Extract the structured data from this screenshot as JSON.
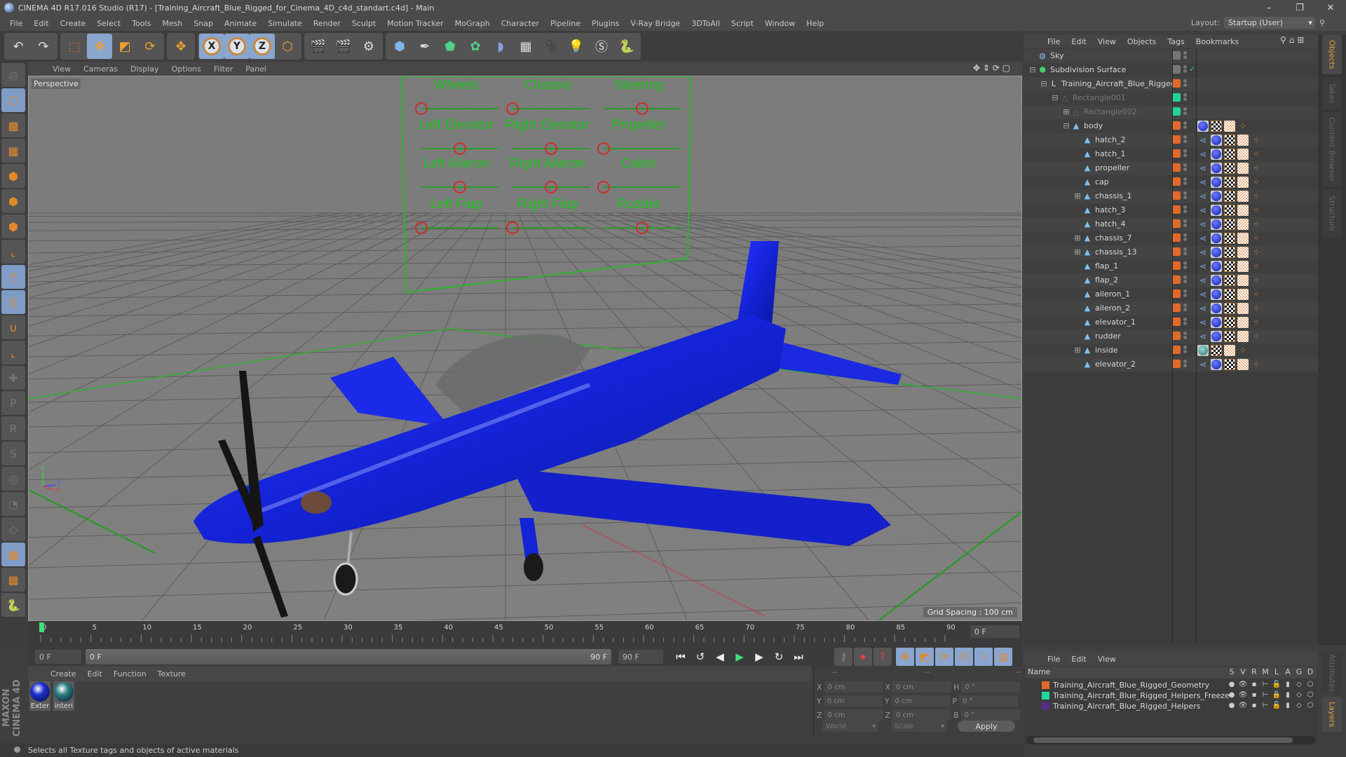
{
  "window": {
    "title": "CINEMA 4D R17.016 Studio (R17) - [Training_Aircraft_Blue_Rigged_for_Cinema_4D_c4d_standart.c4d] - Main",
    "controls": [
      "–",
      "❐",
      "✕"
    ]
  },
  "menubar": {
    "items": [
      "File",
      "Edit",
      "Create",
      "Select",
      "Tools",
      "Mesh",
      "Snap",
      "Animate",
      "Simulate",
      "Render",
      "Sculpt",
      "Motion Tracker",
      "MoGraph",
      "Character",
      "Pipeline",
      "Plugins",
      "V-Ray Bridge",
      "3DToAll",
      "Script",
      "Window",
      "Help"
    ],
    "layout_label": "Layout:",
    "layout_value": "Startup (User)"
  },
  "toolbar": {
    "groups": [
      [
        "undo-icon",
        "redo-icon"
      ],
      [
        "live-selection-icon",
        "move-icon",
        "scale-icon",
        "rotate-icon"
      ],
      [
        "recent-tool-icon"
      ],
      [
        "x-axis-icon",
        "y-axis-icon",
        "z-axis-icon",
        "coordinate-system-icon"
      ],
      [
        "render-view-icon",
        "render-picture-viewer-icon",
        "render-settings-icon"
      ],
      [
        "cube-icon",
        "pen-spline-icon",
        "subdivision-surface-icon",
        "cloner-icon",
        "deformer-icon",
        "floor-icon",
        "camera-icon",
        "light-icon",
        "vray-icon",
        "python-icon"
      ]
    ],
    "axis_labels": [
      "X",
      "Y",
      "Z"
    ]
  },
  "left_tools": [
    "make-editable-icon",
    "model-mode-icon",
    "texture-mode-icon",
    "workplane-mode-icon",
    "points-mode-icon",
    "edges-mode-icon",
    "polygons-mode-icon",
    "axis-mode-icon",
    "tweak-mode-icon",
    "solo-icon",
    "snap-icon",
    "workplane-icon",
    "add-keyframe-icon",
    "record-position-icon",
    "record-rotation-icon",
    "record-psr-icon",
    "record-param-icon",
    "record-pla-icon",
    "record-point-icon",
    "lock-workplane-icon",
    "align-workplane-icon",
    "python-icon"
  ],
  "viewport": {
    "menu": [
      "View",
      "Cameras",
      "Display",
      "Options",
      "Filter",
      "Panel"
    ],
    "label": "Perspective",
    "grid_spacing": "Grid Spacing : 100 cm",
    "nav_icons": "✥ ⇕ ⟳ ▢",
    "rig_panel": {
      "controls": [
        {
          "label": "Wheels",
          "value": 0.0
        },
        {
          "label": "Chassis",
          "value": 0.0
        },
        {
          "label": "Steering",
          "value": 0.5
        },
        {
          "label": "Left Elevator",
          "value": 0.5
        },
        {
          "label": "Right Elevator",
          "value": 0.5
        },
        {
          "label": "Propeller",
          "value": 0.0
        },
        {
          "label": "Left Aileron",
          "value": 0.5
        },
        {
          "label": "Right Aileron",
          "value": 0.5
        },
        {
          "label": "Cabin",
          "value": 0.0
        },
        {
          "label": "Left Flap",
          "value": 0.0
        },
        {
          "label": "Right Flap",
          "value": 0.0
        },
        {
          "label": "Rudder",
          "value": 0.5
        }
      ]
    },
    "axis_gizmo": [
      "Y",
      "Z",
      "X"
    ]
  },
  "timeline": {
    "ticks": [
      "0",
      "5",
      "10",
      "15",
      "20",
      "25",
      "30",
      "35",
      "40",
      "45",
      "50",
      "55",
      "60",
      "65",
      "70",
      "75",
      "80",
      "85",
      "90"
    ],
    "current_frame": "0 F",
    "start_field": "0 F",
    "range_start": "0 F",
    "range_end": "90 F",
    "end_field": "90 F"
  },
  "transport": {
    "buttons": [
      "go-to-start-icon",
      "previous-key-icon",
      "previous-frame-icon",
      "play-icon",
      "next-frame-icon",
      "next-key-icon",
      "go-to-end-icon"
    ],
    "glyphs": [
      "⏮",
      "↺",
      "◀",
      "▶",
      "▶",
      "↻",
      "⏭"
    ],
    "record_buttons": [
      "keyframe-selection-icon",
      "autokey-icon",
      "help-icon"
    ],
    "key_buttons": [
      "key-position-icon",
      "key-scale-icon",
      "key-rotation-icon",
      "key-parameter-icon",
      "key-pla-icon",
      "timeline-window-icon"
    ]
  },
  "material_manager": {
    "menu": [
      "Create",
      "Edit",
      "Function",
      "Texture"
    ],
    "materials": [
      {
        "name": "Exter",
        "color": "#1d2fd0"
      },
      {
        "name": "interi",
        "color": "#2f7f80"
      }
    ]
  },
  "coordinates": {
    "headers": [
      "--",
      "--",
      "--"
    ],
    "rows": [
      {
        "a": "X",
        "av": "0 cm",
        "b": "X",
        "bv": "0 cm",
        "c": "H",
        "cv": "0 °"
      },
      {
        "a": "Y",
        "av": "0 cm",
        "b": "Y",
        "bv": "0 cm",
        "c": "P",
        "cv": "0 °"
      },
      {
        "a": "Z",
        "av": "0 cm",
        "b": "Z",
        "bv": "0 cm",
        "c": "B",
        "cv": "0 °"
      }
    ],
    "mode1": "World",
    "mode2": "Scale",
    "apply": "Apply"
  },
  "status": "Selects all Texture tags and objects of active materials",
  "brand": "MAXON CINEMA 4D",
  "object_manager": {
    "menu": [
      "File",
      "Edit",
      "View",
      "Objects",
      "Tags",
      "Bookmarks"
    ],
    "objects": [
      {
        "name": "Sky",
        "depth": 0,
        "expand": "",
        "icon": "sky",
        "layer": "#777777",
        "dim": false,
        "tags": []
      },
      {
        "name": "Subdivision Surface",
        "depth": 0,
        "expand": "−",
        "icon": "subdiv",
        "layer": "#777777",
        "dim": false,
        "tags": [],
        "check": "✓"
      },
      {
        "name": "Training_Aircraft_Blue_Rigged",
        "depth": 1,
        "expand": "−",
        "icon": "null",
        "layer": "#e06a2a",
        "dim": false,
        "tags": []
      },
      {
        "name": "Rectangle001",
        "depth": 2,
        "expand": "−",
        "icon": "spline",
        "layer": "#1fd29a",
        "dim": true,
        "tags": []
      },
      {
        "name": "Rectangle002",
        "depth": 3,
        "expand": "+",
        "icon": "spline",
        "layer": "#1fd29a",
        "dim": true,
        "tags": []
      },
      {
        "name": "body",
        "depth": 3,
        "expand": "−",
        "icon": "poly",
        "layer": "#e06a2a",
        "dim": false,
        "tags": [
          "mat",
          "uv",
          "tex",
          "bone"
        ]
      },
      {
        "name": "hatch_2",
        "depth": 4,
        "expand": "",
        "icon": "poly",
        "layer": "#e06a2a",
        "dim": false,
        "tags": [
          "link",
          "mat",
          "uv",
          "tex",
          "bone"
        ]
      },
      {
        "name": "hatch_1",
        "depth": 4,
        "expand": "",
        "icon": "poly",
        "layer": "#e06a2a",
        "dim": false,
        "tags": [
          "link",
          "mat",
          "uv",
          "tex",
          "bone"
        ]
      },
      {
        "name": "propeller",
        "depth": 4,
        "expand": "",
        "icon": "poly",
        "layer": "#e06a2a",
        "dim": false,
        "tags": [
          "link",
          "mat",
          "uv",
          "tex",
          "bone"
        ]
      },
      {
        "name": "cap",
        "depth": 4,
        "expand": "",
        "icon": "poly",
        "layer": "#e06a2a",
        "dim": false,
        "tags": [
          "link",
          "mat",
          "uv",
          "tex",
          "bone"
        ]
      },
      {
        "name": "chassis_1",
        "depth": 4,
        "expand": "+",
        "icon": "poly",
        "layer": "#e06a2a",
        "dim": false,
        "tags": [
          "link",
          "mat",
          "uv",
          "tex",
          "bone"
        ]
      },
      {
        "name": "hatch_3",
        "depth": 4,
        "expand": "",
        "icon": "poly",
        "layer": "#e06a2a",
        "dim": false,
        "tags": [
          "link",
          "mat",
          "uv",
          "tex",
          "bone"
        ]
      },
      {
        "name": "hatch_4",
        "depth": 4,
        "expand": "",
        "icon": "poly",
        "layer": "#e06a2a",
        "dim": false,
        "tags": [
          "link",
          "mat",
          "uv",
          "tex",
          "bone"
        ]
      },
      {
        "name": "chassis_7",
        "depth": 4,
        "expand": "+",
        "icon": "poly",
        "layer": "#e06a2a",
        "dim": false,
        "tags": [
          "link",
          "mat",
          "uv",
          "tex",
          "bone"
        ]
      },
      {
        "name": "chassis_13",
        "depth": 4,
        "expand": "+",
        "icon": "poly",
        "layer": "#e06a2a",
        "dim": false,
        "tags": [
          "link",
          "mat",
          "uv",
          "tex",
          "bone"
        ]
      },
      {
        "name": "flap_1",
        "depth": 4,
        "expand": "",
        "icon": "poly",
        "layer": "#e06a2a",
        "dim": false,
        "tags": [
          "link",
          "mat",
          "uv",
          "tex",
          "bone"
        ]
      },
      {
        "name": "flap_2",
        "depth": 4,
        "expand": "",
        "icon": "poly",
        "layer": "#e06a2a",
        "dim": false,
        "tags": [
          "link",
          "mat",
          "uv",
          "tex",
          "bone"
        ]
      },
      {
        "name": "aileron_1",
        "depth": 4,
        "expand": "",
        "icon": "poly",
        "layer": "#e06a2a",
        "dim": false,
        "tags": [
          "link",
          "mat",
          "uv",
          "tex",
          "bone"
        ]
      },
      {
        "name": "aileron_2",
        "depth": 4,
        "expand": "",
        "icon": "poly",
        "layer": "#e06a2a",
        "dim": false,
        "tags": [
          "link",
          "mat",
          "uv",
          "tex",
          "bone"
        ]
      },
      {
        "name": "elevator_1",
        "depth": 4,
        "expand": "",
        "icon": "poly",
        "layer": "#e06a2a",
        "dim": false,
        "tags": [
          "link",
          "mat",
          "uv",
          "tex",
          "bone"
        ]
      },
      {
        "name": "rudder",
        "depth": 4,
        "expand": "",
        "icon": "poly",
        "layer": "#e06a2a",
        "dim": false,
        "tags": [
          "link",
          "mat",
          "uv",
          "tex",
          "bone"
        ]
      },
      {
        "name": "inside",
        "depth": 4,
        "expand": "+",
        "icon": "poly",
        "layer": "#e06a2a",
        "dim": false,
        "tags": [
          "mat2",
          "uv",
          "tex",
          "bone"
        ]
      },
      {
        "name": "elevator_2",
        "depth": 4,
        "expand": "",
        "icon": "poly",
        "layer": "#e06a2a",
        "dim": false,
        "tags": [
          "link",
          "mat",
          "uv",
          "tex",
          "bone"
        ]
      }
    ]
  },
  "right_tabs": [
    {
      "label": "Objects",
      "active": true
    },
    {
      "label": "Takes",
      "active": false
    },
    {
      "label": "Content Browser",
      "active": false
    },
    {
      "label": "Structure",
      "active": false
    }
  ],
  "right_tabs_bottom": [
    {
      "label": "Attributes",
      "active": false
    },
    {
      "label": "Layers",
      "active": true
    }
  ],
  "layer_manager": {
    "menu": [
      "File",
      "Edit",
      "View"
    ],
    "columns": [
      "Name",
      "S",
      "V",
      "R",
      "M",
      "L",
      "A",
      "G",
      "D"
    ],
    "layers": [
      {
        "name": "Training_Aircraft_Blue_Rigged_Geometry",
        "color": "#e06a2a",
        "locked": false
      },
      {
        "name": "Training_Aircraft_Blue_Rigged_Helpers_Freeze",
        "color": "#22d99a",
        "locked": true
      },
      {
        "name": "Training_Aircraft_Blue_Rigged_Helpers",
        "color": "#5a2a8a",
        "locked": false
      }
    ]
  }
}
